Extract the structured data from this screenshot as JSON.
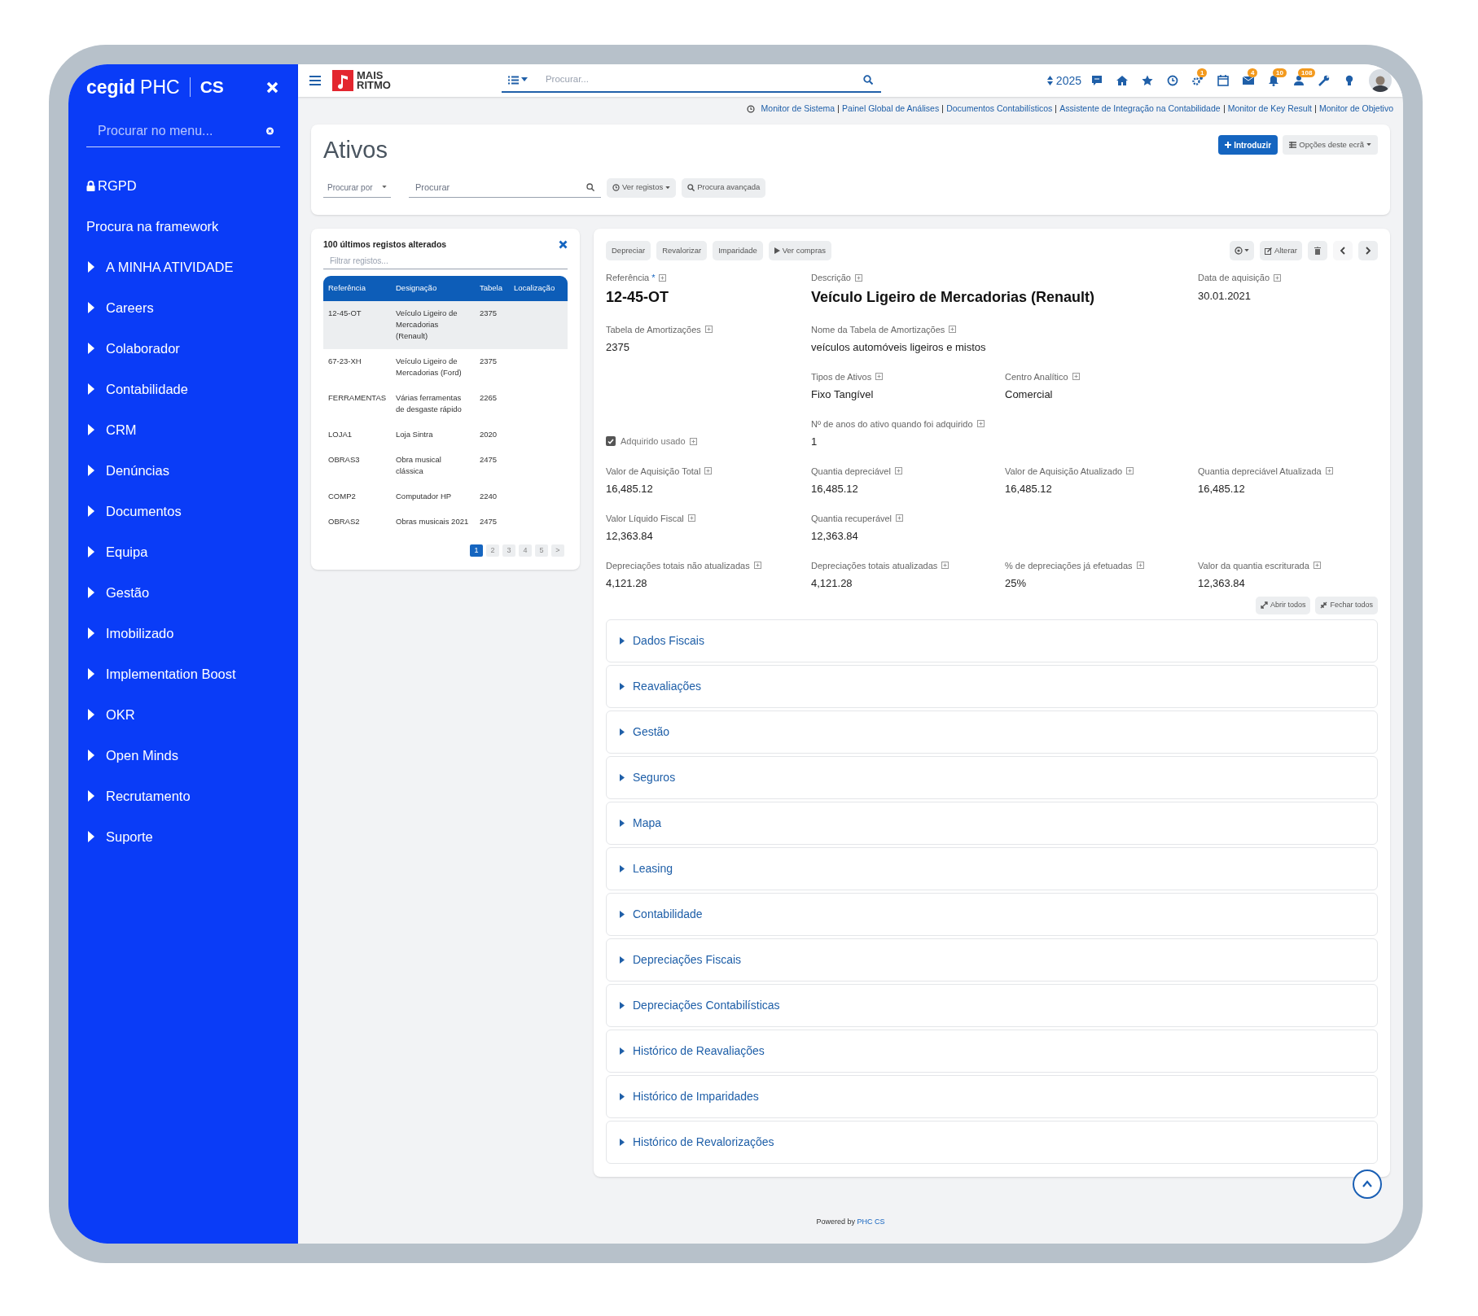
{
  "sidebar": {
    "brand": {
      "logo": "cegid",
      "product": "PHC",
      "suffix": "CS"
    },
    "search": {
      "placeholder": "Procurar no menu..."
    },
    "items": [
      {
        "label": "RGPD",
        "kind": "locked"
      },
      {
        "label": "Procura na framework",
        "kind": "plain"
      },
      {
        "label": "A MINHA ATIVIDADE",
        "kind": "group",
        "expanded": false
      },
      {
        "label": "Careers",
        "kind": "group",
        "expanded": false
      },
      {
        "label": "Colaborador",
        "kind": "group",
        "expanded": false
      },
      {
        "label": "Contabilidade",
        "kind": "group",
        "expanded": false
      },
      {
        "label": "CRM",
        "kind": "group",
        "expanded": false
      },
      {
        "label": "Denúncias",
        "kind": "group",
        "expanded": false
      },
      {
        "label": "Documentos",
        "kind": "group",
        "expanded": false
      },
      {
        "label": "Equipa",
        "kind": "group",
        "expanded": false
      },
      {
        "label": "Gestão",
        "kind": "group",
        "expanded": false
      },
      {
        "label": "Imobilizado",
        "kind": "group",
        "expanded": false
      },
      {
        "label": "Implementation Boost",
        "kind": "group",
        "expanded": false
      },
      {
        "label": "OKR",
        "kind": "group",
        "expanded": false
      },
      {
        "label": "Open Minds",
        "kind": "group",
        "expanded": false
      },
      {
        "label": "Recrutamento",
        "kind": "group",
        "expanded": false
      },
      {
        "label": "Suporte",
        "kind": "group",
        "expanded": false
      }
    ]
  },
  "topbar": {
    "logo": {
      "line1": "MAIS",
      "line2": "RITMO"
    },
    "search": {
      "placeholder": "Procurar..."
    },
    "year": "2025",
    "icons": [
      {
        "kind": "chat"
      },
      {
        "kind": "home"
      },
      {
        "kind": "star"
      },
      {
        "kind": "clock"
      },
      {
        "kind": "gears",
        "badge": "1"
      },
      {
        "kind": "calendar"
      },
      {
        "kind": "mail",
        "badge": "4"
      },
      {
        "kind": "bell",
        "badge": "10"
      },
      {
        "kind": "users",
        "badge": "108"
      },
      {
        "kind": "wrench"
      },
      {
        "kind": "bulb"
      },
      {
        "kind": "avatar"
      }
    ]
  },
  "quick_links": [
    "Monitor de Sistema",
    "Painel Global de Análises",
    "Documentos Contabilísticos",
    "Assistente de Integração na Contabilidade",
    "Monitor de Key Result",
    "Monitor de Objetivo"
  ],
  "page": {
    "title": "Ativos",
    "search_by": {
      "placeholder": "Procurar por"
    },
    "search": {
      "placeholder": "Procurar"
    },
    "buttons": [
      {
        "label": "Ver registos",
        "kind": "history"
      },
      {
        "label": "Procura avançada",
        "kind": "advanced"
      }
    ],
    "actions": [
      {
        "label": "Introduzir",
        "kind": "primary"
      },
      {
        "label": "Opções deste ecrã",
        "kind": "options"
      }
    ]
  },
  "recent": {
    "title": "100 últimos registos alterados",
    "filter": {
      "placeholder": "Filtrar registos..."
    },
    "columns": [
      "Referência",
      "Designação",
      "Tabela",
      "Localização"
    ],
    "rows": [
      {
        "cells": [
          "12-45-OT",
          "Veículo Ligeiro de Mercadorias (Renault)",
          "2375"
        ],
        "selected": true
      },
      {
        "cells": [
          "67-23-XH",
          "Veículo Ligeiro de Mercadorias (Ford)",
          "2375"
        ],
        "selected": false
      },
      {
        "cells": [
          "FERRAMENTAS",
          "Várias ferramentas de desgaste rápido",
          "2265"
        ],
        "selected": false
      },
      {
        "cells": [
          "LOJA1",
          "Loja Sintra",
          "2020"
        ],
        "selected": false
      },
      {
        "cells": [
          "OBRAS3",
          "Obra musical clássica",
          "2475"
        ],
        "selected": false
      },
      {
        "cells": [
          "COMP2",
          "Computador HP",
          "2240"
        ],
        "selected": false
      },
      {
        "cells": [
          "OBRAS2",
          "Obras musicais 2021",
          "2475"
        ],
        "selected": false
      }
    ],
    "pages": [
      {
        "label": "1",
        "selected": true
      },
      {
        "label": "2",
        "selected": false
      },
      {
        "label": "3",
        "selected": false
      },
      {
        "label": "4",
        "selected": false
      },
      {
        "label": "5",
        "selected": false
      },
      {
        "label": ">",
        "selected": false
      }
    ]
  },
  "detail": {
    "toolbar": [
      {
        "label": "Depreciar",
        "kind": "plain"
      },
      {
        "label": "Revalorizar",
        "kind": "plain"
      },
      {
        "label": "Imparidade",
        "kind": "plain"
      },
      {
        "label": "Ver compras",
        "kind": "play"
      }
    ],
    "edit_button": "Alterar",
    "field_rows": [
      [
        {
          "label": "Referência",
          "required_mark": "*",
          "value": "12-45-OT",
          "kind": "title"
        },
        {
          "label": "Descrição",
          "value": "Veículo Ligeiro de Mercadorias (Renault)",
          "kind": "title"
        },
        null,
        {
          "label": "Data de aquisição",
          "value": "30.01.2021",
          "kind": "plain"
        }
      ],
      [
        {
          "label": "Tabela de Amortizações",
          "value": "2375",
          "kind": "plain"
        },
        {
          "label": "Nome da Tabela de Amortizações",
          "value": "veículos automóveis ligeiros e mistos",
          "kind": "plain"
        },
        null,
        null
      ],
      [
        null,
        {
          "label": "Tipos de Ativos",
          "value": "Fixo Tangível",
          "kind": "plain"
        },
        {
          "label": "Centro Analítico",
          "value": "Comercial",
          "kind": "plain"
        },
        null
      ],
      [
        {
          "label": "Adquirido usado",
          "kind": "checkbox",
          "checked": true
        },
        {
          "label": "Nº de anos do ativo quando foi adquirido",
          "value": "1",
          "kind": "plain"
        },
        null,
        null
      ],
      [
        {
          "label": "Valor de Aquisição Total",
          "value": "16,485.12",
          "kind": "plain"
        },
        {
          "label": "Quantia depreciável",
          "value": "16,485.12",
          "kind": "plain"
        },
        {
          "label": "Valor de Aquisição Atualizado",
          "value": "16,485.12",
          "kind": "plain"
        },
        {
          "label": "Quantia depreciável Atualizada",
          "value": "16,485.12",
          "kind": "plain"
        }
      ],
      [
        {
          "label": "Valor Líquido Fiscal",
          "value": "12,363.84",
          "kind": "plain"
        },
        {
          "label": "Quantia recuperável",
          "value": "12,363.84",
          "kind": "plain"
        },
        null,
        null
      ],
      [
        {
          "label": "Depreciações totais não atualizadas",
          "value": "4,121.28",
          "kind": "plain"
        },
        {
          "label": "Depreciações totais atualizadas",
          "value": "4,121.28",
          "kind": "plain"
        },
        {
          "label": "% de depreciações já efetuadas",
          "value": "25%",
          "kind": "plain"
        },
        {
          "label": "Valor da quantia escriturada",
          "value": "12,363.84",
          "kind": "plain"
        }
      ]
    ],
    "expand_buttons": [
      {
        "label": "Abrir todos",
        "kind": "expand"
      },
      {
        "label": "Fechar todos",
        "kind": "collapse"
      }
    ],
    "sections": [
      {
        "label": "Dados Fiscais",
        "expanded": false
      },
      {
        "label": "Reavaliações",
        "expanded": false
      },
      {
        "label": "Gestão",
        "expanded": false
      },
      {
        "label": "Seguros",
        "expanded": false
      },
      {
        "label": "Mapa",
        "expanded": false
      },
      {
        "label": "Leasing",
        "expanded": false
      },
      {
        "label": "Contabilidade",
        "expanded": false
      },
      {
        "label": "Depreciações Fiscais",
        "expanded": false
      },
      {
        "label": "Depreciações Contabilísticas",
        "expanded": false
      },
      {
        "label": "Histórico de Reavaliações",
        "expanded": false
      },
      {
        "label": "Histórico de Imparidades",
        "expanded": false
      },
      {
        "label": "Histórico de Revalorizações",
        "expanded": false
      }
    ]
  },
  "footer": {
    "prefix": "Powered by",
    "brand": "PHC CS"
  }
}
